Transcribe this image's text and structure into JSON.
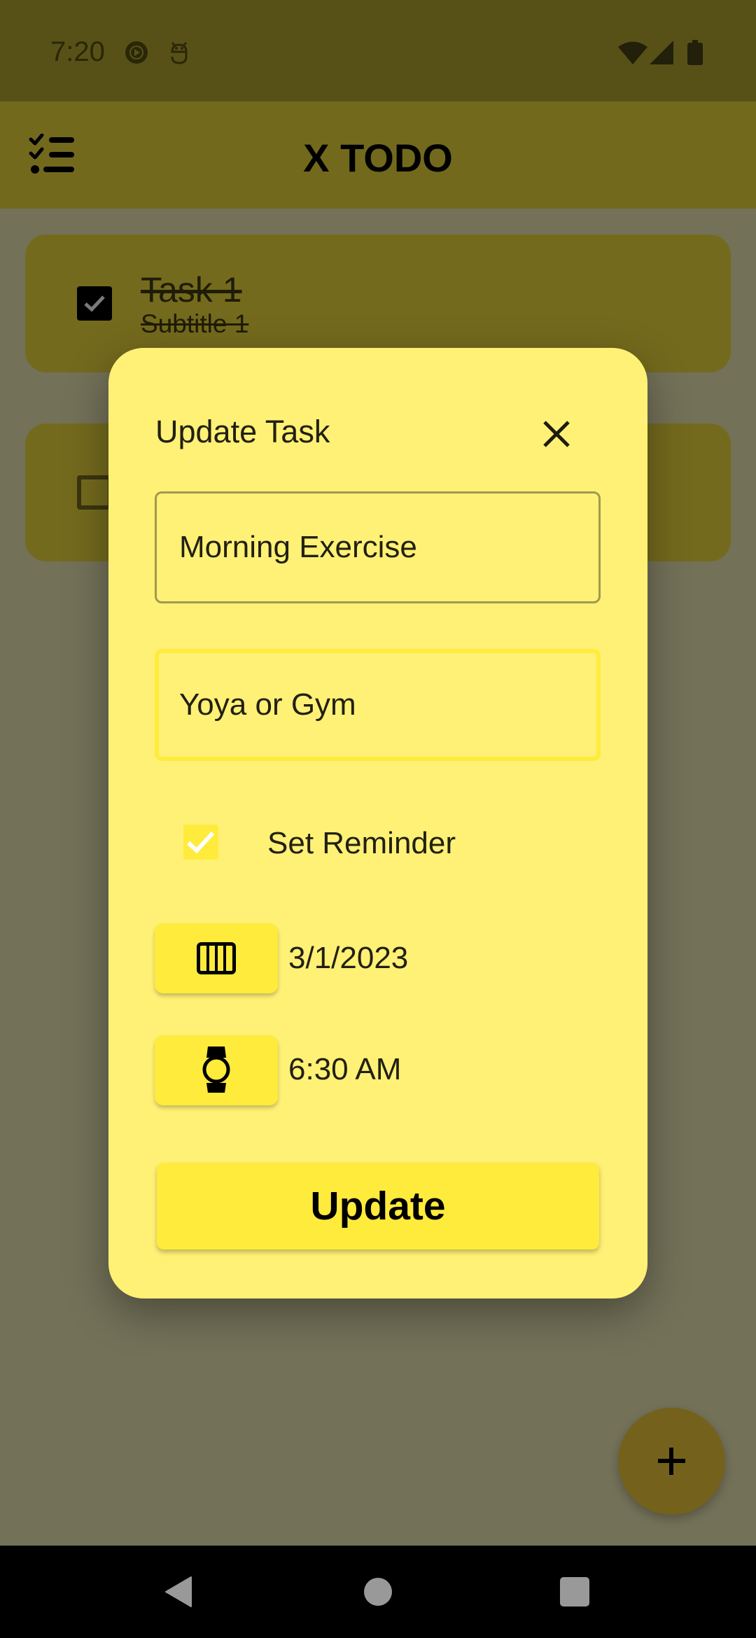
{
  "status_bar": {
    "time": "7:20",
    "left_icons": [
      "media-play-icon",
      "android-debug-icon"
    ],
    "right_icons": [
      "wifi-icon",
      "cellular-signal-icon",
      "battery-icon"
    ]
  },
  "app_bar": {
    "title": "X TODO",
    "leading_icon": "checklist-icon"
  },
  "tasks": [
    {
      "title": "Task 1",
      "subtitle": "Subtitle 1",
      "done": true
    },
    {
      "title": "",
      "subtitle": "",
      "done": false
    }
  ],
  "dialog": {
    "title": "Update Task",
    "close_icon": "close-icon",
    "title_field": {
      "value": "Morning Exercise"
    },
    "subtitle_field": {
      "value": "Yoya or Gym"
    },
    "reminder": {
      "label": "Set Reminder",
      "checked": true
    },
    "date": {
      "icon": "calendar-icon",
      "value": "3/1/2023"
    },
    "time": {
      "icon": "watch-icon",
      "value": "6:30 AM"
    },
    "submit_label": "Update"
  },
  "fab": {
    "icon": "add-icon"
  },
  "nav_bar": {
    "buttons": [
      "back",
      "home",
      "recents"
    ]
  },
  "colors": {
    "status_bar": "#575117",
    "app_bar": "#73691d",
    "dialog_bg": "#fff176",
    "accent": "#ffeb3b",
    "scrim": "#737158",
    "fab": "#74621c"
  }
}
